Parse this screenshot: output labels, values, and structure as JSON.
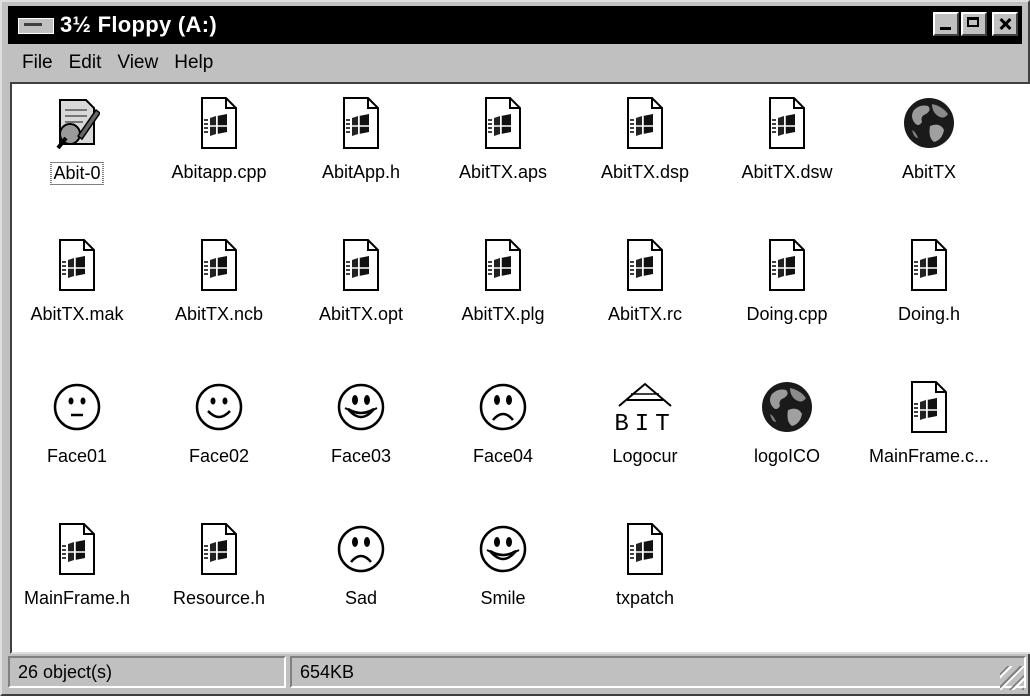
{
  "window": {
    "title": "3½ Floppy (A:)"
  },
  "menu": [
    "File",
    "Edit",
    "View",
    "Help"
  ],
  "items": [
    {
      "name": "Abit-0",
      "icon": "help-document-icon",
      "kind": "help",
      "selected": true
    },
    {
      "name": "Abitapp.cpp",
      "icon": "document-icon",
      "kind": "doc"
    },
    {
      "name": "AbitApp.h",
      "icon": "document-icon",
      "kind": "doc"
    },
    {
      "name": "AbitTX.aps",
      "icon": "document-icon",
      "kind": "doc"
    },
    {
      "name": "AbitTX.dsp",
      "icon": "document-icon",
      "kind": "doc"
    },
    {
      "name": "AbitTX.dsw",
      "icon": "document-icon",
      "kind": "doc"
    },
    {
      "name": "AbitTX",
      "icon": "globe-icon",
      "kind": "globe"
    },
    {
      "name": "AbitTX.mak",
      "icon": "document-icon",
      "kind": "doc"
    },
    {
      "name": "AbitTX.ncb",
      "icon": "document-icon",
      "kind": "doc"
    },
    {
      "name": "AbitTX.opt",
      "icon": "document-icon",
      "kind": "doc"
    },
    {
      "name": "AbitTX.plg",
      "icon": "document-icon",
      "kind": "doc"
    },
    {
      "name": "AbitTX.rc",
      "icon": "document-icon",
      "kind": "doc"
    },
    {
      "name": "Doing.cpp",
      "icon": "document-icon",
      "kind": "doc"
    },
    {
      "name": "Doing.h",
      "icon": "document-icon",
      "kind": "doc"
    },
    {
      "name": "Face01",
      "icon": "neutral-face-icon",
      "kind": "neutral"
    },
    {
      "name": "Face02",
      "icon": "smile-face-icon",
      "kind": "smile-small"
    },
    {
      "name": "Face03",
      "icon": "smile-face-icon",
      "kind": "smile-big"
    },
    {
      "name": "Face04",
      "icon": "sad-face-icon",
      "kind": "sad"
    },
    {
      "name": "Logocur",
      "icon": "house-logo-icon",
      "kind": "house"
    },
    {
      "name": "logoICO",
      "icon": "globe-icon",
      "kind": "globe"
    },
    {
      "name": "MainFrame.c...",
      "icon": "document-icon",
      "kind": "doc"
    },
    {
      "name": "MainFrame.h",
      "icon": "document-icon",
      "kind": "doc"
    },
    {
      "name": "Resource.h",
      "icon": "document-icon",
      "kind": "doc"
    },
    {
      "name": "Sad",
      "icon": "sad-face-icon",
      "kind": "sad"
    },
    {
      "name": "Smile",
      "icon": "smile-face-icon",
      "kind": "smile-big"
    },
    {
      "name": "txpatch",
      "icon": "document-icon",
      "kind": "doc"
    }
  ],
  "house_logo_text": "BIT",
  "status": {
    "count": "26 object(s)",
    "size": "654KB"
  }
}
